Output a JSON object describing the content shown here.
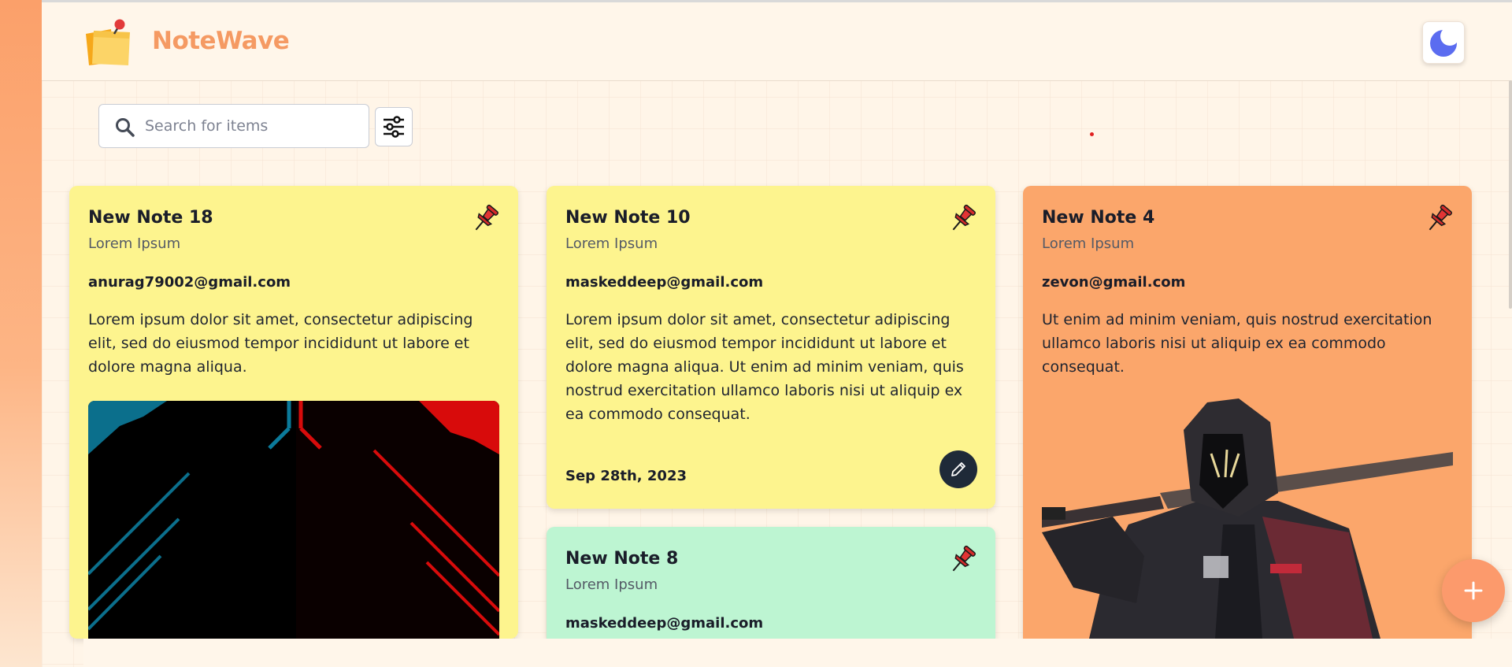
{
  "brand": {
    "name": "NoteWave"
  },
  "search": {
    "placeholder": "Search for items",
    "value": ""
  },
  "notes": [
    {
      "title": "New Note 18",
      "subtitle": "Lorem Ipsum",
      "email": "anurag79002@gmail.com",
      "body": "Lorem ipsum dolor sit amet, consectetur adipiscing elit, sed do eiusmod tempor incididunt ut labore et dolore magna aliqua.",
      "color": "#fdf48e",
      "has_image": true
    },
    {
      "title": "New Note 10",
      "subtitle": "Lorem Ipsum",
      "email": "maskeddeep@gmail.com",
      "body": "Lorem ipsum dolor sit amet, consectetur adipiscing elit, sed do eiusmod tempor incididunt ut labore et dolore magna aliqua. Ut enim ad minim veniam, quis nostrud exercitation ullamco laboris nisi ut aliquip ex ea commodo consequat.",
      "date": "Sep 28th, 2023",
      "color": "#fdf48e"
    },
    {
      "title": "New Note 8",
      "subtitle": "Lorem Ipsum",
      "email": "maskeddeep@gmail.com",
      "color": "#bdf5d2"
    },
    {
      "title": "New Note 4",
      "subtitle": "Lorem Ipsum",
      "email": "zevon@gmail.com",
      "body": "Ut enim ad minim veniam, quis nostrud exercitation ullamco laboris nisi ut aliquip ex ea commodo consequat.",
      "color": "#fba66b",
      "has_image": true
    }
  ],
  "icons": {
    "logo": "sticky-note-icon",
    "theme": "moon-icon",
    "search": "search-icon",
    "filter": "sliders-icon",
    "pin": "pushpin-icon",
    "edit": "pencil-icon",
    "add": "plus-icon"
  },
  "colors": {
    "accent": "#f59a63",
    "fab": "#fc9a6c",
    "edit_button": "#1f2a38",
    "moon": "#5b6cf0"
  }
}
